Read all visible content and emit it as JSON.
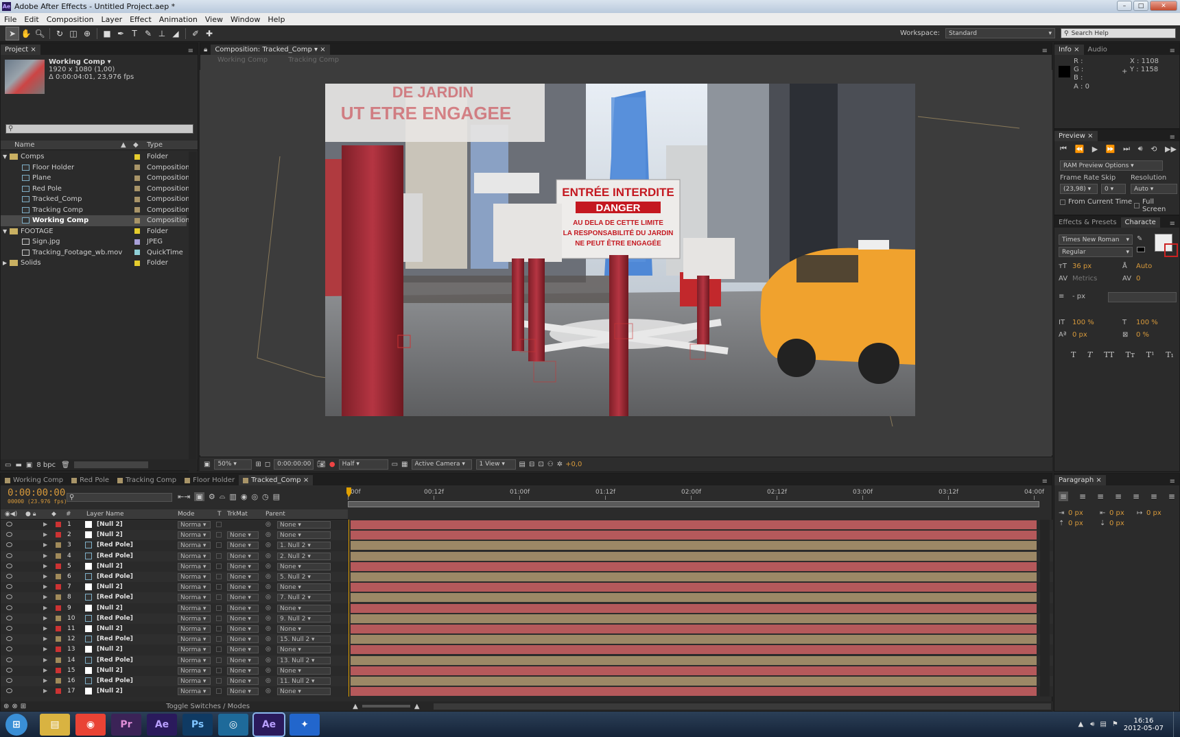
{
  "window": {
    "title": "Adobe After Effects - Untitled Project.aep *",
    "app_logo": "Ae"
  },
  "menu": [
    "File",
    "Edit",
    "Composition",
    "Layer",
    "Effect",
    "Animation",
    "View",
    "Window",
    "Help"
  ],
  "toolbar": {
    "workspace_label": "Workspace:",
    "workspace_value": "Standard",
    "search_placeholder": "Search Help"
  },
  "project": {
    "tab": "Project",
    "selected_name": "Working Comp ▾",
    "selected_dims": "1920 x 1080 (1,00)",
    "selected_dur": "Δ 0:00:04:01, 23,976 fps",
    "col_name": "Name",
    "col_type": "Type",
    "items": [
      {
        "name": "Comps",
        "type": "Folder",
        "kind": "folder",
        "indent": 0,
        "swatch": "#e5cc2d"
      },
      {
        "name": "Floor Holder",
        "type": "Composition",
        "kind": "comp",
        "indent": 1,
        "swatch": "#a89468"
      },
      {
        "name": "Plane",
        "type": "Composition",
        "kind": "comp",
        "indent": 1,
        "swatch": "#a89468"
      },
      {
        "name": "Red Pole",
        "type": "Composition",
        "kind": "comp",
        "indent": 1,
        "swatch": "#a89468"
      },
      {
        "name": "Tracked_Comp",
        "type": "Composition",
        "kind": "comp",
        "indent": 1,
        "swatch": "#a89468"
      },
      {
        "name": "Tracking Comp",
        "type": "Composition",
        "kind": "comp",
        "indent": 1,
        "swatch": "#a89468"
      },
      {
        "name": "Working Comp",
        "type": "Composition",
        "kind": "comp",
        "indent": 1,
        "swatch": "#a89468",
        "selected": true
      },
      {
        "name": "FOOTAGE",
        "type": "Folder",
        "kind": "folder",
        "indent": 0,
        "swatch": "#e5cc2d"
      },
      {
        "name": "Sign.jpg",
        "type": "JPEG",
        "kind": "file",
        "indent": 1,
        "swatch": "#a8a0d8"
      },
      {
        "name": "Tracking_Footage_wb.mov",
        "type": "QuickTime",
        "kind": "file",
        "indent": 1,
        "swatch": "#8fd0d8"
      },
      {
        "name": "Solids",
        "type": "Folder",
        "kind": "folder",
        "indent": 0,
        "swatch": "#e5cc2d"
      }
    ],
    "bpc": "8 bpc"
  },
  "composition": {
    "tab": "Composition: Tracked_Comp",
    "breadcrumbs": [
      "Working Comp",
      "Tracking Comp"
    ],
    "footer": {
      "zoom": "50%",
      "timecode": "0:00:00:00",
      "resolution": "Half",
      "camera": "Active Camera",
      "views": "1 View",
      "exposure": "+0,0"
    },
    "scene_signs": [
      "ENTRÉE INTERDITE",
      "DANGER",
      "AU DELA DE CETTE LIMITE",
      "LA RESPONSABILITÉ DU JARDIN",
      "NE PEUT ÊTRE ENGAGÉE",
      "DE JARDIN",
      "UT ETRE ENGAGEE"
    ]
  },
  "info": {
    "tabs": [
      "Info",
      "Audio"
    ],
    "r": "R :",
    "g": "G :",
    "b": "B :",
    "a": "A : 0",
    "x": "X : 1108",
    "y": "Y : 1158"
  },
  "preview": {
    "tab": "Preview",
    "ram": "RAM Preview Options",
    "frame_rate_label": "Frame Rate",
    "skip_label": "Skip",
    "resolution_label": "Resolution",
    "frame_rate": "(23,98)",
    "skip": "0",
    "resolution": "Auto",
    "from_current": "From Current Time",
    "full_screen": "Full Screen"
  },
  "character": {
    "tabs": [
      "Effects & Presets",
      "Characte"
    ],
    "font": "Times New Roman",
    "style": "Regular",
    "size": "36 px",
    "leading": "Auto",
    "kerning": "Metrics",
    "tracking": "0",
    "stroke": "- px",
    "vscale": "100 %",
    "hscale": "100 %",
    "baseline": "0 px",
    "tsume": "0 %",
    "styles": [
      "T",
      "T",
      "TT",
      "Tт",
      "T¹",
      "T₁"
    ]
  },
  "paragraph": {
    "tab": "Paragraph",
    "v1": "0 px",
    "v2": "0 px",
    "v3": "0 px",
    "v4": "0 px",
    "v5": "0 px"
  },
  "timeline": {
    "tabs": [
      "Working Comp",
      "Red Pole",
      "Tracking Comp",
      "Floor Holder",
      "Tracked_Comp"
    ],
    "timecode": "0:00:00:00",
    "fps": "00000 (23.976 fps)",
    "headers": {
      "num": "#",
      "name": "Layer Name",
      "mode": "Mode",
      "t": "T",
      "trkmat": "TrkMat",
      "parent": "Parent"
    },
    "ruler": [
      "00f",
      "00:12f",
      "01:00f",
      "01:12f",
      "02:00f",
      "02:12f",
      "03:00f",
      "03:12f",
      "04:00f"
    ],
    "footer": "Toggle Switches / Modes",
    "layers": [
      {
        "n": "1",
        "name": "[Null 2]",
        "kind": "null",
        "trk": "",
        "parent": "None"
      },
      {
        "n": "2",
        "name": "[Null 2]",
        "kind": "null",
        "trk": "None",
        "parent": "None"
      },
      {
        "n": "3",
        "name": "[Red Pole]",
        "kind": "comp",
        "trk": "None",
        "parent": "1. Null 2"
      },
      {
        "n": "4",
        "name": "[Red Pole]",
        "kind": "comp",
        "trk": "None",
        "parent": "2. Null 2"
      },
      {
        "n": "5",
        "name": "[Null 2]",
        "kind": "null",
        "trk": "None",
        "parent": "None"
      },
      {
        "n": "6",
        "name": "[Red Pole]",
        "kind": "comp",
        "trk": "None",
        "parent": "5. Null 2"
      },
      {
        "n": "7",
        "name": "[Null 2]",
        "kind": "null",
        "trk": "None",
        "parent": "None"
      },
      {
        "n": "8",
        "name": "[Red Pole]",
        "kind": "comp",
        "trk": "None",
        "parent": "7. Null 2"
      },
      {
        "n": "9",
        "name": "[Null 2]",
        "kind": "null",
        "trk": "None",
        "parent": "None"
      },
      {
        "n": "10",
        "name": "[Red Pole]",
        "kind": "comp",
        "trk": "None",
        "parent": "9. Null 2"
      },
      {
        "n": "11",
        "name": "[Null 2]",
        "kind": "null",
        "trk": "None",
        "parent": "None"
      },
      {
        "n": "12",
        "name": "[Red Pole]",
        "kind": "comp",
        "trk": "None",
        "parent": "15. Null 2"
      },
      {
        "n": "13",
        "name": "[Null 2]",
        "kind": "null",
        "trk": "None",
        "parent": "None"
      },
      {
        "n": "14",
        "name": "[Red Pole]",
        "kind": "comp",
        "trk": "None",
        "parent": "13. Null 2"
      },
      {
        "n": "15",
        "name": "[Null 2]",
        "kind": "null",
        "trk": "None",
        "parent": "None"
      },
      {
        "n": "16",
        "name": "[Red Pole]",
        "kind": "comp",
        "trk": "None",
        "parent": "11. Null 2"
      },
      {
        "n": "17",
        "name": "[Null 2]",
        "kind": "null",
        "trk": "None",
        "parent": "None"
      }
    ],
    "mode_value": "Norma",
    "colors": {
      "null_bar": "#b5595b",
      "comp_bar": "#9c8866",
      "null_label": "#c33",
      "comp_label": "#a08a5a"
    }
  },
  "taskbar": {
    "apps": [
      {
        "name": "start-orb",
        "label": "⊞"
      },
      {
        "name": "explorer",
        "label": "▤"
      },
      {
        "name": "chrome",
        "label": "◉"
      },
      {
        "name": "premiere",
        "label": "Pr"
      },
      {
        "name": "after-effects-inactive",
        "label": "Ae"
      },
      {
        "name": "photoshop",
        "label": "Ps"
      },
      {
        "name": "media",
        "label": "◎"
      },
      {
        "name": "after-effects",
        "label": "Ae"
      },
      {
        "name": "app-blue",
        "label": "✦"
      }
    ],
    "time": "16:16",
    "date": "2012-05-07"
  }
}
